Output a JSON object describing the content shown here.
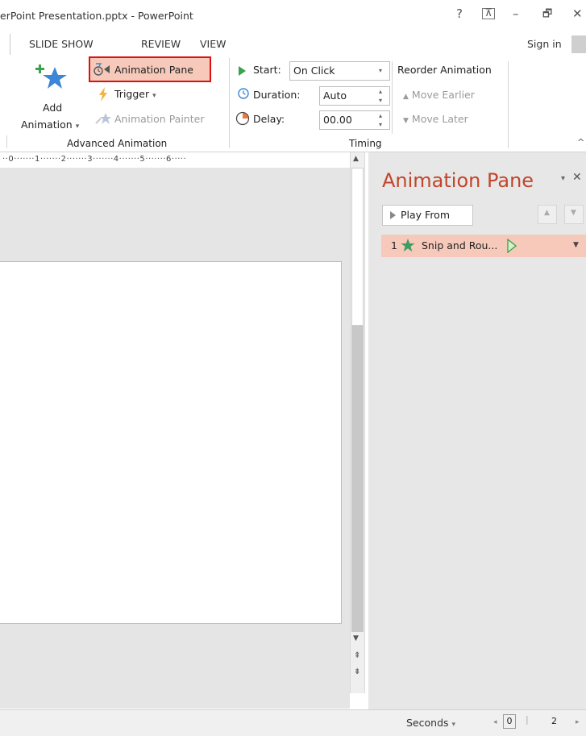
{
  "window": {
    "title": "erPoint Presentation.pptx - PowerPoint",
    "help_glyph": "?",
    "ribbon_options_glyph": "⊼",
    "minimize_glyph": "–",
    "restore_glyph": "🗗",
    "close_glyph": "✕"
  },
  "tabs": [
    "SLIDE SHOW",
    "REVIEW",
    "VIEW"
  ],
  "account": {
    "sign_in": "Sign in"
  },
  "ribbon": {
    "advanced_animation": {
      "add_animation_line1": "Add",
      "add_animation_line2": "Animation",
      "add_animation_caret": "▾",
      "animation_pane": "Animation Pane",
      "trigger": "Trigger",
      "trigger_caret": "▾",
      "animation_painter": "Animation Painter",
      "group_label": "Advanced Animation"
    },
    "timing": {
      "start_label": "Start:",
      "start_value": "On Click",
      "duration_label": "Duration:",
      "duration_value": "Auto",
      "delay_label": "Delay:",
      "delay_value": "00.00",
      "group_label": "Timing"
    },
    "reorder": {
      "title": "Reorder Animation",
      "move_earlier": "Move Earlier",
      "move_later": "Move Later"
    },
    "collapse_glyph": "^"
  },
  "ruler": {
    "text": "··0·······1·······2·······3·······4·······5·······6·····"
  },
  "animation_pane": {
    "title": "Animation Pane",
    "menu_glyph": "▾",
    "close_glyph": "✕",
    "play_from": "Play From",
    "items": [
      {
        "index": "1",
        "name": "Snip and Rou..."
      }
    ],
    "timeline_label": "Seconds",
    "timeline_caret": "▾",
    "timeline_values": [
      "0",
      "2"
    ]
  },
  "colors": {
    "accent_orange": "#c0462b",
    "highlight_fill": "#f6c9ba",
    "highlight_border": "#dd1111",
    "star_blue": "#3b86d6",
    "play_green": "#3aa24b"
  }
}
